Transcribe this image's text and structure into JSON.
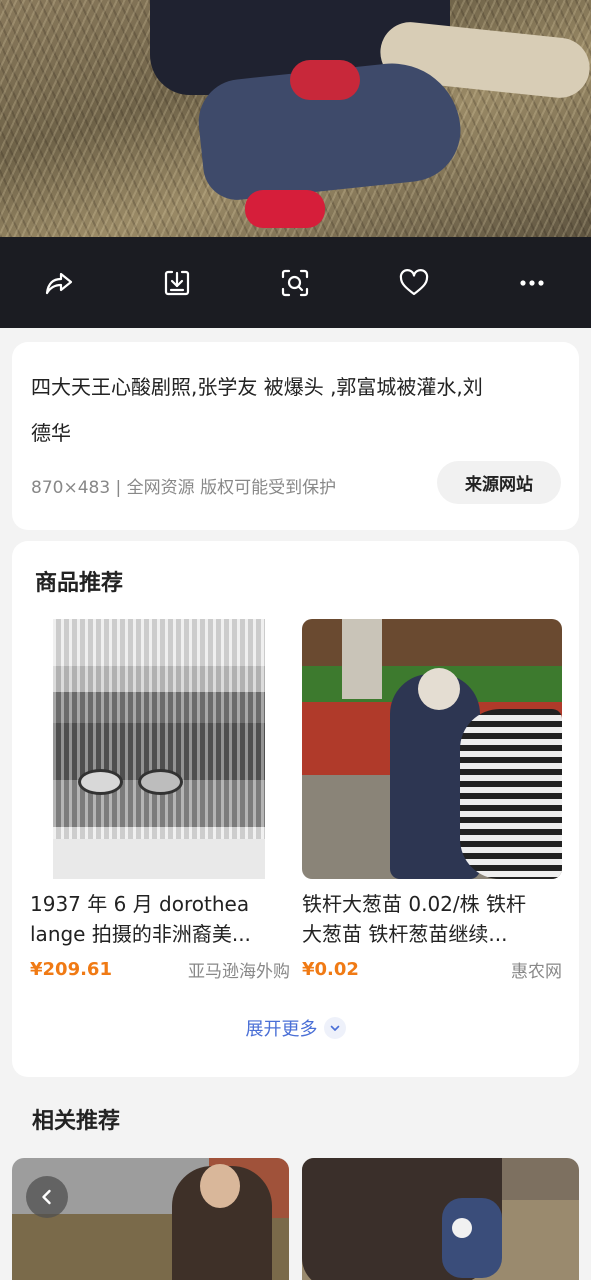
{
  "toolbar": {
    "icons": [
      "share-icon",
      "download-icon",
      "scan-icon",
      "heart-icon",
      "more-icon"
    ]
  },
  "info": {
    "title_line1": "四大天王心酸剧照,张学友 被爆头 ,郭富城被灌水,刘",
    "title_line2": "德华",
    "meta": "870×483 | 全网资源 版权可能受到保护",
    "source_button": "来源网站"
  },
  "goods": {
    "section_title": "商品推荐",
    "products": [
      {
        "name_line1": "1937 年 6 月 dorothea",
        "name_line2": "lange 拍摄的非洲裔美...",
        "price": "¥209.61",
        "seller": "亚马逊海外购"
      },
      {
        "name_line1": "铁杆大葱苗 0.02/株 铁杆",
        "name_line2": "大葱苗 铁杆葱苗继续...",
        "price": "¥0.02",
        "seller": "惠农网"
      }
    ],
    "more_label": "展开更多"
  },
  "related": {
    "section_title": "相关推荐"
  },
  "colors": {
    "toolbar_bg": "#1b1c22",
    "price": "#f07a14",
    "link": "#4a6fd6",
    "page_bg": "#f3f3f3"
  }
}
